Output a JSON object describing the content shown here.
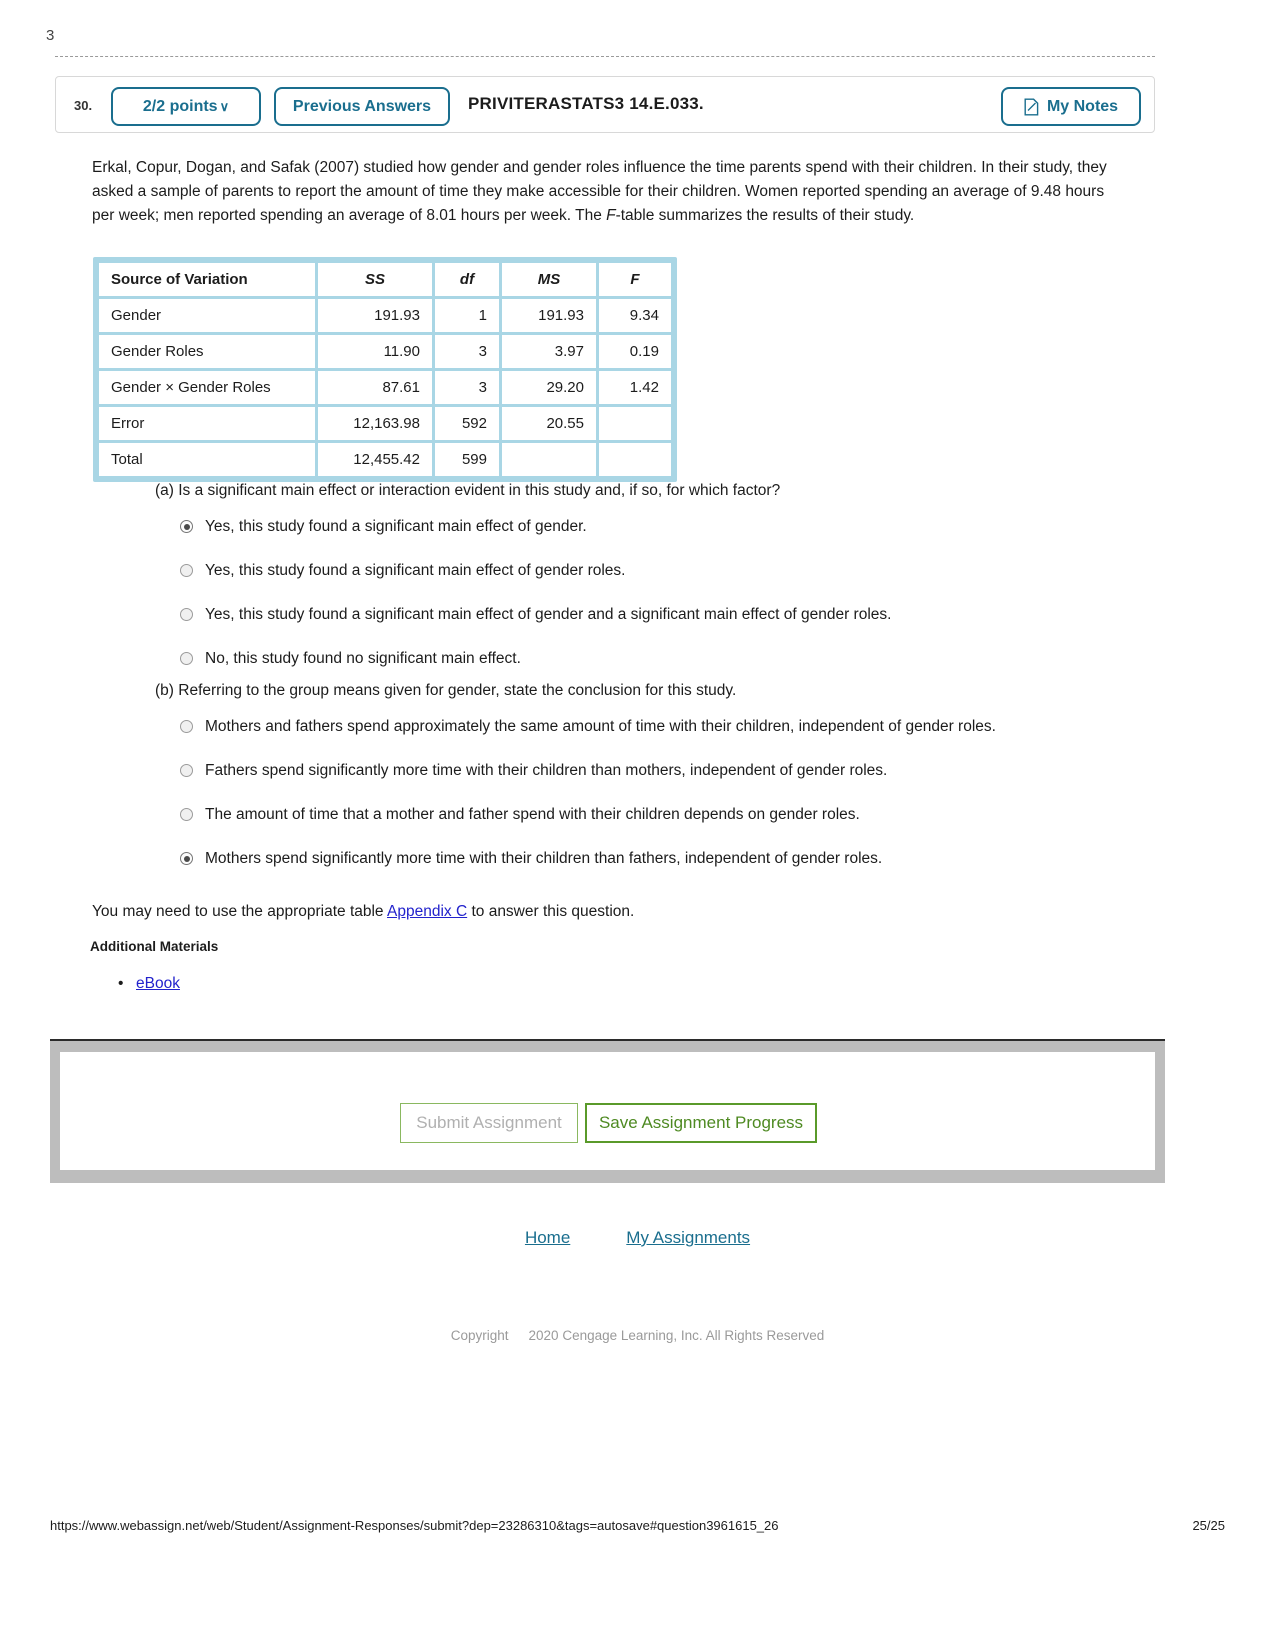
{
  "stray_glyph": "3",
  "question_header": {
    "number": "30.",
    "points_label": "2/2 points",
    "points_chevron": "∨",
    "previous_answers_label": "Previous Answers",
    "question_code": "PRIVITERASTATS3 14.E.033.",
    "my_notes_label": "My Notes"
  },
  "problem": {
    "text_part1": "Erkal, Copur, Dogan, and Safak (2007) studied how gender and gender roles influence the time parents spend with their children. In their study, they asked a sample of parents to report the amount of time they make accessible for their children. Women reported spending an average of 9.48 hours per week; men reported spending an average of 8.01 hours per week. The ",
    "italic_f": "F",
    "text_part2": "-table summarizes the results of their study."
  },
  "anova_table": {
    "headers": [
      "Source of Variation",
      "SS",
      "df",
      "MS",
      "F"
    ],
    "rows": [
      {
        "source": "Gender",
        "ss": "191.93",
        "df": "1",
        "ms": "191.93",
        "f": "9.34"
      },
      {
        "source": "Gender Roles",
        "ss": "11.90",
        "df": "3",
        "ms": "3.97",
        "f": "0.19"
      },
      {
        "source": "Gender × Gender Roles",
        "ss": "87.61",
        "df": "3",
        "ms": "29.20",
        "f": "1.42"
      },
      {
        "source": "Error",
        "ss": "12,163.98",
        "df": "592",
        "ms": "20.55",
        "f": ""
      },
      {
        "source": "Total",
        "ss": "12,455.42",
        "df": "599",
        "ms": "",
        "f": ""
      }
    ]
  },
  "part_a": {
    "prompt": "(a) Is a significant main effect or interaction evident in this study and, if so, for which factor?",
    "options": [
      {
        "label": "Yes, this study found a significant main effect of gender.",
        "selected": true
      },
      {
        "label": "Yes, this study found a significant main effect of gender roles.",
        "selected": false
      },
      {
        "label": "Yes, this study found a significant main effect of gender and a significant main effect of gender roles.",
        "selected": false
      },
      {
        "label": "No, this study found no significant main effect.",
        "selected": false
      }
    ]
  },
  "part_b": {
    "prompt": "(b) Referring to the group means given for gender, state the conclusion for this study.",
    "options": [
      {
        "label": "Mothers and fathers spend approximately the same amount of time with their children, independent of gender roles.",
        "selected": false
      },
      {
        "label": "Fathers spend significantly more time with their children than mothers, independent of gender roles.",
        "selected": false
      },
      {
        "label": "The amount of time that a mother and father spend with their children depends on gender roles.",
        "selected": false
      },
      {
        "label": "Mothers spend significantly more time with their children than fathers, independent of gender roles.",
        "selected": true
      }
    ]
  },
  "appendix": {
    "text_before": "You may need to use the appropriate table ",
    "link_label": "Appendix C",
    "text_after": " to answer this question."
  },
  "additional_materials": {
    "heading": "Additional Materials",
    "bullet": "•",
    "items": [
      "eBook"
    ]
  },
  "submit_panel": {
    "submit_label": "Submit Assignment",
    "save_label": "Save Assignment Progress"
  },
  "footer": {
    "links": [
      "Home",
      "My Assignments"
    ],
    "copyright_word": "Copyright",
    "copyright_text": "2020 Cengage Learning, Inc. All Rights Reserved"
  },
  "print_footer": {
    "url": "https://www.webassign.net/web/Student/Assignment-Responses/submit?dep=23286310&tags=autosave#question3961615_26",
    "page": "25/25"
  },
  "colors": {
    "accent_blue": "#1a6e8e",
    "table_border_blue": "#a9d6e5",
    "link_blue": "#2222cc",
    "save_green": "#4e8a22",
    "panel_grey": "#bdbdbd"
  }
}
